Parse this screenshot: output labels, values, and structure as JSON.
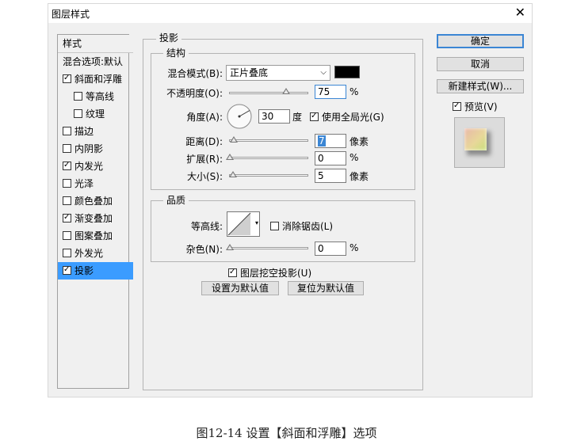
{
  "window": {
    "title": "图层样式",
    "close_glyph": "✕"
  },
  "style_list": {
    "header": "样式",
    "items": [
      {
        "label": "混合选项:默认",
        "checkbox": false,
        "checked": false,
        "indent": false
      },
      {
        "label": "斜面和浮雕",
        "checkbox": true,
        "checked": true,
        "indent": false
      },
      {
        "label": "等高线",
        "checkbox": true,
        "checked": false,
        "indent": true
      },
      {
        "label": "纹理",
        "checkbox": true,
        "checked": false,
        "indent": true
      },
      {
        "label": "描边",
        "checkbox": true,
        "checked": false,
        "indent": false
      },
      {
        "label": "内阴影",
        "checkbox": true,
        "checked": false,
        "indent": false
      },
      {
        "label": "内发光",
        "checkbox": true,
        "checked": true,
        "indent": false
      },
      {
        "label": "光泽",
        "checkbox": true,
        "checked": false,
        "indent": false
      },
      {
        "label": "颜色叠加",
        "checkbox": true,
        "checked": false,
        "indent": false
      },
      {
        "label": "渐变叠加",
        "checkbox": true,
        "checked": true,
        "indent": false
      },
      {
        "label": "图案叠加",
        "checkbox": true,
        "checked": false,
        "indent": false
      },
      {
        "label": "外发光",
        "checkbox": true,
        "checked": false,
        "indent": false
      },
      {
        "label": "投影",
        "checkbox": true,
        "checked": true,
        "indent": false,
        "selected": true
      }
    ]
  },
  "drop_shadow": {
    "section_title": "投影",
    "structure": {
      "title": "结构",
      "blend_mode_label": "混合模式(B):",
      "blend_mode_value": "正片叠底",
      "blend_color": "#000000",
      "opacity_label": "不透明度(O):",
      "opacity_value": "75",
      "opacity_unit": "%",
      "angle_label": "角度(A):",
      "angle_value": "30",
      "angle_unit": "度",
      "global_light_label": "使用全局光(G)",
      "global_light_checked": true,
      "distance_label": "距离(D):",
      "distance_value": "7",
      "distance_unit": "像素",
      "spread_label": "扩展(R):",
      "spread_value": "0",
      "spread_unit": "%",
      "size_label": "大小(S):",
      "size_value": "5",
      "size_unit": "像素"
    },
    "quality": {
      "title": "品质",
      "contour_label": "等高线:",
      "antialias_label": "消除锯齿(L)",
      "antialias_checked": false,
      "noise_label": "杂色(N):",
      "noise_value": "0",
      "noise_unit": "%"
    },
    "knockout_label": "图层挖空投影(U)",
    "knockout_checked": true,
    "make_default_label": "设置为默认值",
    "reset_default_label": "复位为默认值"
  },
  "side_buttons": {
    "ok": "确定",
    "cancel": "取消",
    "new_style": "新建样式(W)...",
    "preview_label": "预览(V)",
    "preview_checked": true
  },
  "caption": "图12-14 设置【斜面和浮雕】选项"
}
